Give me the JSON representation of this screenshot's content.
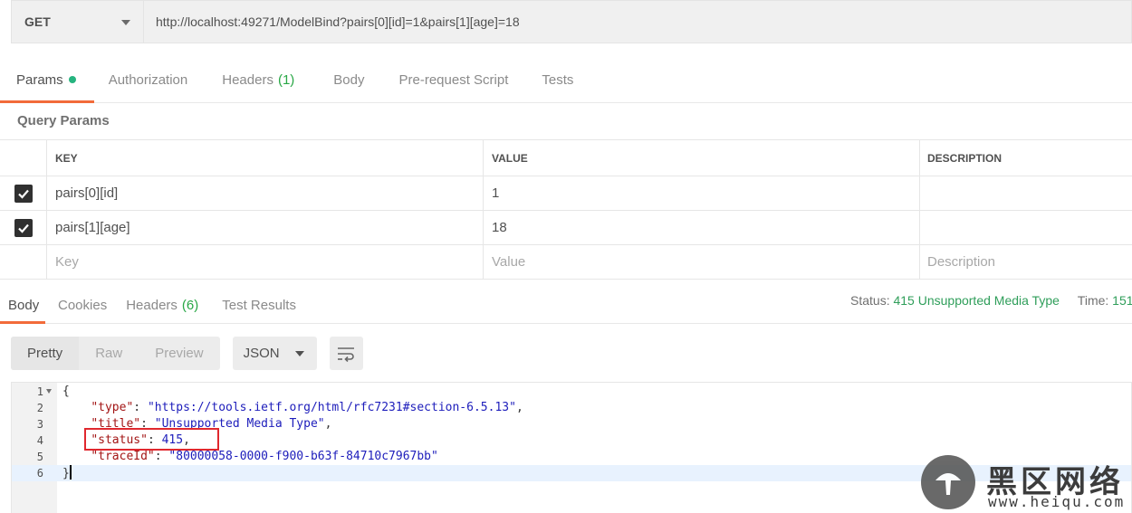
{
  "request": {
    "method": "GET",
    "url": "http://localhost:49271/ModelBind?pairs[0][id]=1&pairs[1][age]=18"
  },
  "request_tabs": [
    {
      "label": "Params",
      "active": true,
      "dot": true
    },
    {
      "label": "Authorization"
    },
    {
      "label": "Headers",
      "count": "(1)"
    },
    {
      "label": "Body"
    },
    {
      "label": "Pre-request Script"
    },
    {
      "label": "Tests"
    }
  ],
  "query_params": {
    "title": "Query Params",
    "headers": {
      "key": "KEY",
      "value": "VALUE",
      "description": "DESCRIPTION"
    },
    "rows": [
      {
        "checked": true,
        "key": "pairs[0][id]",
        "value": "1",
        "description": ""
      },
      {
        "checked": true,
        "key": "pairs[1][age]",
        "value": "18",
        "description": ""
      }
    ],
    "placeholders": {
      "key": "Key",
      "value": "Value",
      "description": "Description"
    }
  },
  "response_tabs": [
    {
      "label": "Body",
      "active": true
    },
    {
      "label": "Cookies"
    },
    {
      "label": "Headers",
      "count": "(6)"
    },
    {
      "label": "Test Results"
    }
  ],
  "response_status": {
    "status_label": "Status:",
    "status_value": "415 Unsupported Media Type",
    "time_label": "Time:",
    "time_value": "151"
  },
  "view_modes": [
    "Pretty",
    "Raw",
    "Preview"
  ],
  "format": "JSON",
  "code_lines": [
    {
      "n": "1",
      "text": "{"
    },
    {
      "n": "2",
      "text": "    \"type\": \"https://tools.ietf.org/html/rfc7231#section-6.5.13\","
    },
    {
      "n": "3",
      "text": "    \"title\": \"Unsupported Media Type\","
    },
    {
      "n": "4",
      "text": "    \"status\": 415,"
    },
    {
      "n": "5",
      "text": "    \"traceId\": \"80000058-0000-f900-b63f-84710c7967bb\""
    },
    {
      "n": "6",
      "text": "}"
    }
  ],
  "watermark": {
    "brand": "黑区网络",
    "url": "www.heiqu.com"
  },
  "colors": {
    "accent": "#f26b3a",
    "success": "#2f9e5a",
    "highlight": "#e0282e"
  }
}
